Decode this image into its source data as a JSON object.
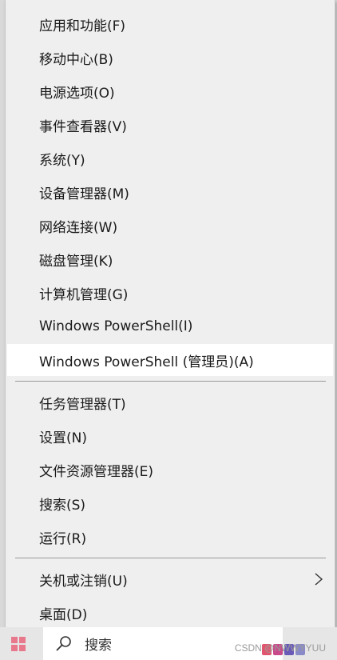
{
  "menu": {
    "group1": [
      {
        "label": "应用和功能(F)"
      },
      {
        "label": "移动中心(B)"
      },
      {
        "label": "电源选项(O)"
      },
      {
        "label": "事件查看器(V)"
      },
      {
        "label": "系统(Y)"
      },
      {
        "label": "设备管理器(M)"
      },
      {
        "label": "网络连接(W)"
      },
      {
        "label": "磁盘管理(K)"
      },
      {
        "label": "计算机管理(G)"
      },
      {
        "label": "Windows PowerShell(I)"
      },
      {
        "label": "Windows PowerShell (管理员)(A)",
        "highlighted": true
      }
    ],
    "group2": [
      {
        "label": "任务管理器(T)"
      },
      {
        "label": "设置(N)"
      },
      {
        "label": "文件资源管理器(E)"
      },
      {
        "label": "搜索(S)"
      },
      {
        "label": "运行(R)"
      }
    ],
    "group3": [
      {
        "label": "关机或注销(U)",
        "has_submenu": true,
        "submenu_icon": "chevron-right-icon"
      },
      {
        "label": "桌面(D)"
      }
    ]
  },
  "taskbar": {
    "search_placeholder": "搜索",
    "start_icon": "windows-logo-icon",
    "search_icon": "search-icon"
  },
  "watermark": "CSDN @NWWYYUU",
  "colors": {
    "menu_bg": "#efefef",
    "highlight_bg": "#ffffff",
    "text": "#1a1a1a",
    "separator": "#9a9a9a"
  }
}
